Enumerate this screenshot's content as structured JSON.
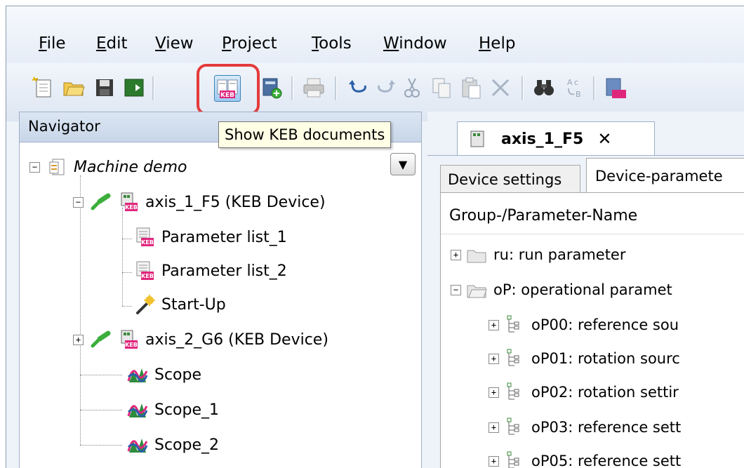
{
  "menu": {
    "items": [
      {
        "label": "File",
        "u": "F",
        "rest": "ile"
      },
      {
        "label": "Edit",
        "u": "E",
        "rest": "dit"
      },
      {
        "label": "View",
        "u": "V",
        "rest": "iew"
      },
      {
        "label": "Project",
        "u": "P",
        "rest": "roject"
      },
      {
        "label": "Tools",
        "u": "T",
        "rest": "ools"
      },
      {
        "label": "Window",
        "u": "W",
        "rest": "indow"
      },
      {
        "label": "Help",
        "u": "H",
        "rest": "elp"
      }
    ]
  },
  "toolbar": {
    "tooltip": "Show KEB documents",
    "highlight_color": "#e43b3b"
  },
  "navigator": {
    "title": "Navigator",
    "root": "Machine demo",
    "items": [
      {
        "label": "axis_1_F5 (KEB Device)",
        "icon": "keb-device-icon"
      },
      {
        "label": "Parameter list_1",
        "icon": "parameter-list-icon"
      },
      {
        "label": "Parameter list_2",
        "icon": "parameter-list-icon"
      },
      {
        "label": "Start-Up",
        "icon": "magic-wand-icon"
      },
      {
        "label": "axis_2_G6 (KEB Device)",
        "icon": "keb-device-icon"
      },
      {
        "label": "Scope",
        "icon": "scope-icon"
      },
      {
        "label": "Scope_1",
        "icon": "scope-icon"
      },
      {
        "label": "Scope_2",
        "icon": "scope-icon"
      }
    ]
  },
  "document": {
    "tab_label": "axis_1_F5",
    "close_symbol": "✕",
    "subtabs": [
      "Device settings",
      "Device-paramete"
    ],
    "grid_header": "Group-/Parameter-Name",
    "groups": [
      {
        "label": "ru: run parameter",
        "expanded": false
      },
      {
        "label": "oP: operational paramet",
        "expanded": true
      }
    ],
    "params": [
      "oP00: reference sou",
      "oP01: rotation sourc",
      "oP02: rotation settir",
      "oP03: reference sett",
      "oP05: reference sett"
    ]
  }
}
